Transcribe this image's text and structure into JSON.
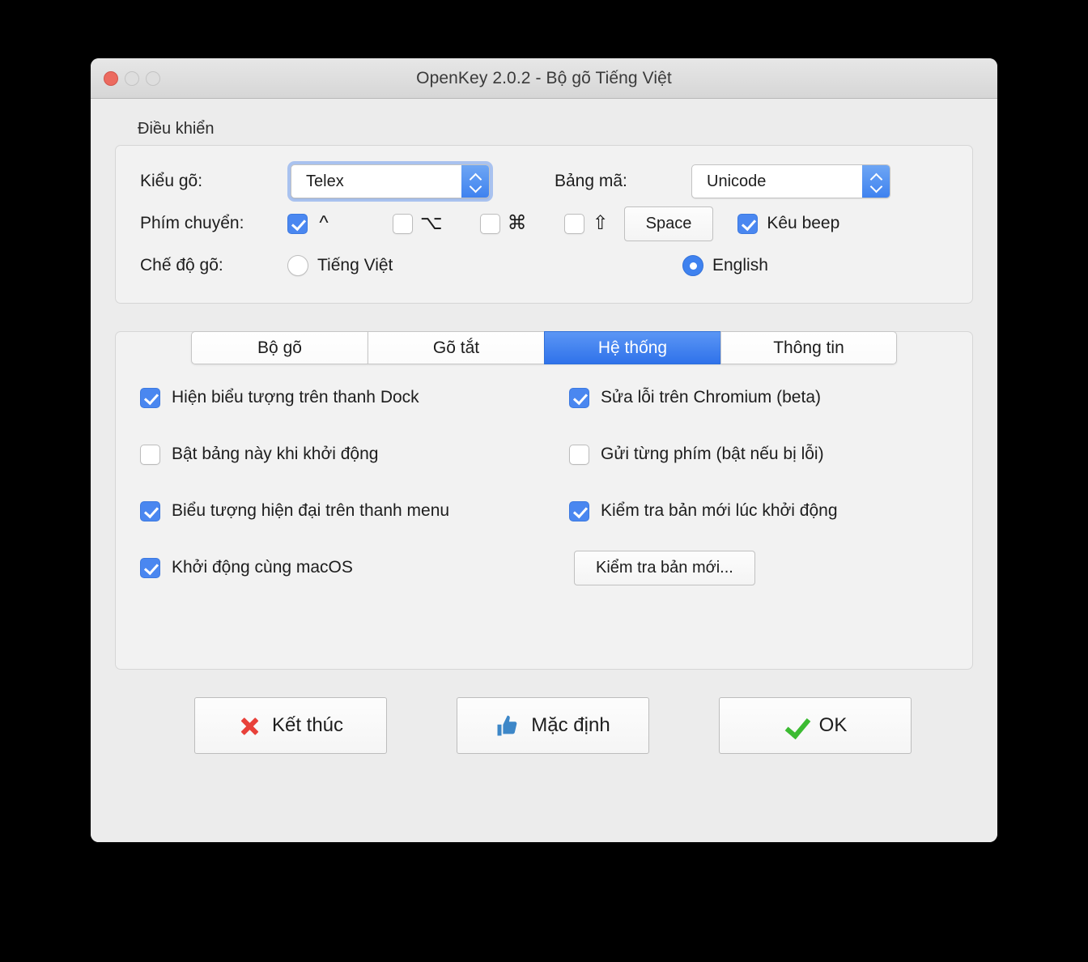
{
  "window": {
    "title": "OpenKey 2.0.2 - Bộ gõ Tiếng Việt",
    "traffic": {
      "close": "close-button",
      "minimize": "minimize-button",
      "maximize": "maximize-button"
    }
  },
  "control_group": {
    "legend": "Điều khiển",
    "input_method": {
      "label": "Kiểu gõ:",
      "value": "Telex",
      "focused": true
    },
    "charset": {
      "label": "Bảng mã:",
      "value": "Unicode"
    },
    "switch_key": {
      "label": "Phím chuyển:",
      "modifiers": [
        {
          "glyph": "^",
          "name": "control-key",
          "checked": true
        },
        {
          "glyph": "⌥",
          "name": "option-key",
          "checked": false
        },
        {
          "glyph": "⌘",
          "name": "command-key",
          "checked": false
        },
        {
          "glyph": "⇧",
          "name": "shift-key",
          "checked": false
        }
      ],
      "space_button": "Space",
      "beep": {
        "label": "Kêu beep",
        "checked": true
      }
    },
    "typing_mode": {
      "label": "Chế độ gõ:",
      "options": [
        {
          "label": "Tiếng Việt",
          "selected": false
        },
        {
          "label": "English",
          "selected": true
        }
      ]
    }
  },
  "tabs": [
    {
      "label": "Bộ gõ",
      "active": false
    },
    {
      "label": "Gõ tắt",
      "active": false
    },
    {
      "label": "Hệ thống",
      "active": true
    },
    {
      "label": "Thông tin",
      "active": false
    }
  ],
  "system_tab": {
    "left_options": [
      {
        "label": "Hiện biểu tượng trên thanh Dock",
        "checked": true
      },
      {
        "label": "Bật bảng này khi khởi động",
        "checked": false
      },
      {
        "label": "Biểu tượng hiện đại trên thanh menu",
        "checked": true
      },
      {
        "label": "Khởi động cùng macOS",
        "checked": true
      }
    ],
    "right_options": [
      {
        "label": "Sửa lỗi trên Chromium (beta)",
        "checked": true
      },
      {
        "label": "Gửi từng phím (bật nếu bị lỗi)",
        "checked": false
      },
      {
        "label": "Kiểm tra bản mới lúc khởi động",
        "checked": true
      }
    ],
    "check_update_button": "Kiểm tra bản mới..."
  },
  "footer": {
    "quit": "Kết thúc",
    "defaults": "Mặc định",
    "ok": "OK"
  },
  "colors": {
    "accent_blue": "#4a87f0",
    "tab_active_blue": "#2f72ea",
    "close_red": "#ec6a5f",
    "x_red": "#e8413a",
    "check_green": "#3cbb32",
    "thumb_blue": "#3d87c8",
    "window_bg": "#ececec",
    "panel_bg": "#f2f2f2"
  }
}
